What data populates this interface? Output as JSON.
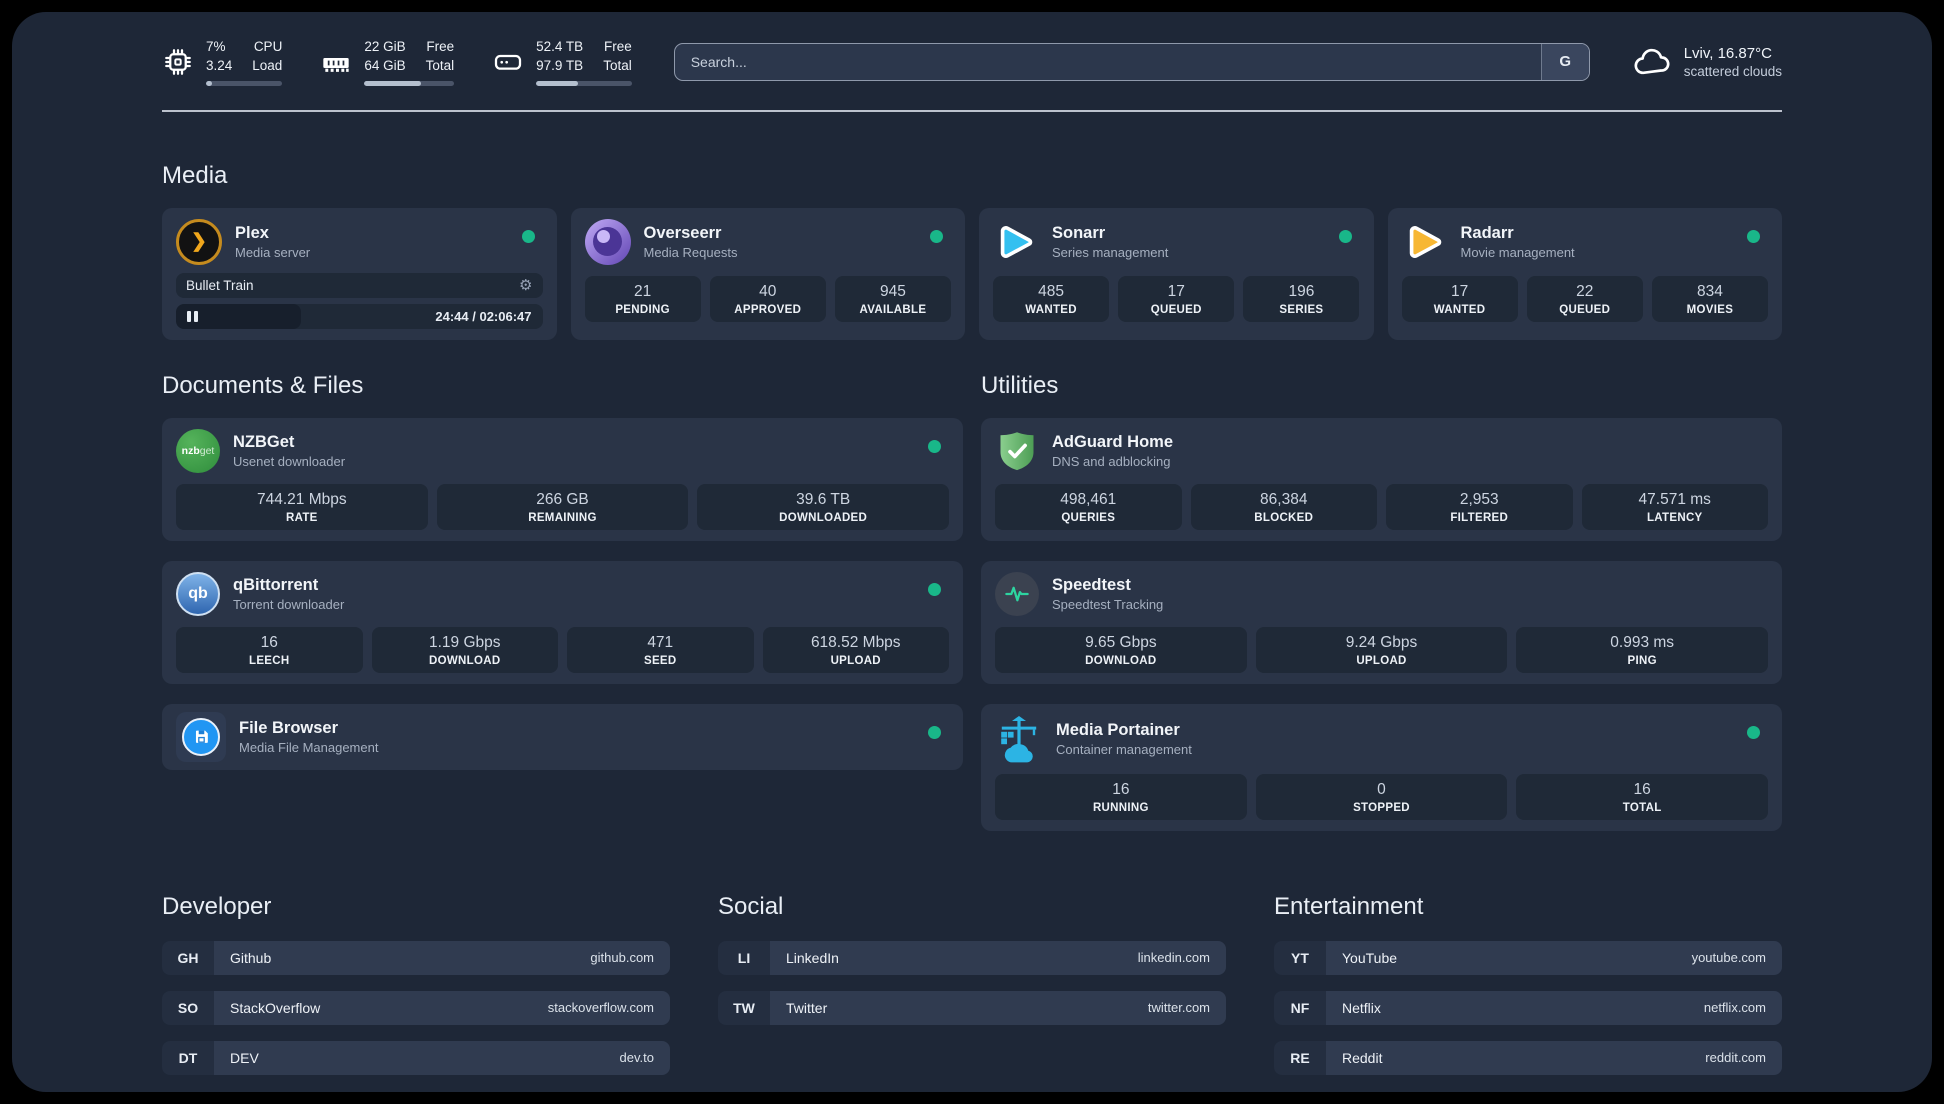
{
  "colors": {
    "status_green": "#19b789",
    "plex_orange": "#f0a71c",
    "sonarr_blue": "#33c0f0",
    "radarr_yellow": "#f7b733",
    "filebrowser_blue": "#2196f3",
    "speedtest_green": "#2dd4a0",
    "portainer_cyan": "#2cb4e4"
  },
  "header": {
    "system_stats": [
      {
        "icon": "cpu-icon",
        "values": [
          "7%",
          "3.24"
        ],
        "labels": [
          "CPU",
          "Load"
        ],
        "progress_percent": 8
      },
      {
        "icon": "ram-icon",
        "values": [
          "22 GiB",
          "64 GiB"
        ],
        "labels": [
          "Free",
          "Total"
        ],
        "progress_percent": 63
      },
      {
        "icon": "disk-icon",
        "values": [
          "52.4 TB",
          "97.9 TB"
        ],
        "labels": [
          "Free",
          "Total"
        ],
        "progress_percent": 44
      }
    ],
    "search": {
      "placeholder": "Search...",
      "button_label": "G"
    },
    "weather": {
      "location": "Lviv, 16.87°C",
      "condition": "scattered clouds"
    }
  },
  "sections": {
    "media": {
      "title": "Media",
      "plex": {
        "title": "Plex",
        "subtitle": "Media server",
        "now_playing": "Bullet Train",
        "time": "24:44 / 02:06:47",
        "elapsed_percent": 34
      },
      "overseerr": {
        "title": "Overseerr",
        "subtitle": "Media Requests",
        "stats": [
          {
            "value": "21",
            "label": "PENDING"
          },
          {
            "value": "40",
            "label": "APPROVED"
          },
          {
            "value": "945",
            "label": "AVAILABLE"
          }
        ]
      },
      "sonarr": {
        "title": "Sonarr",
        "subtitle": "Series management",
        "stats": [
          {
            "value": "485",
            "label": "WANTED"
          },
          {
            "value": "17",
            "label": "QUEUED"
          },
          {
            "value": "196",
            "label": "SERIES"
          }
        ]
      },
      "radarr": {
        "title": "Radarr",
        "subtitle": "Movie management",
        "stats": [
          {
            "value": "17",
            "label": "WANTED"
          },
          {
            "value": "22",
            "label": "QUEUED"
          },
          {
            "value": "834",
            "label": "MOVIES"
          }
        ]
      }
    },
    "documents": {
      "title": "Documents & Files",
      "nzbget": {
        "title": "NZBGet",
        "subtitle": "Usenet downloader",
        "icon_text_1": "nzb",
        "icon_text_2": "get",
        "stats": [
          {
            "value": "744.21 Mbps",
            "label": "RATE"
          },
          {
            "value": "266 GB",
            "label": "REMAINING"
          },
          {
            "value": "39.6 TB",
            "label": "DOWNLOADED"
          }
        ]
      },
      "qbittorrent": {
        "title": "qBittorrent",
        "subtitle": "Torrent downloader",
        "icon_text": "qb",
        "stats": [
          {
            "value": "16",
            "label": "LEECH"
          },
          {
            "value": "1.19 Gbps",
            "label": "DOWNLOAD"
          },
          {
            "value": "471",
            "label": "SEED"
          },
          {
            "value": "618.52 Mbps",
            "label": "UPLOAD"
          }
        ]
      },
      "filebrowser": {
        "title": "File Browser",
        "subtitle": "Media File Management"
      }
    },
    "utilities": {
      "title": "Utilities",
      "adguard": {
        "title": "AdGuard Home",
        "subtitle": "DNS and adblocking",
        "stats": [
          {
            "value": "498,461",
            "label": "QUERIES"
          },
          {
            "value": "86,384",
            "label": "BLOCKED"
          },
          {
            "value": "2,953",
            "label": "FILTERED"
          },
          {
            "value": "47.571 ms",
            "label": "LATENCY"
          }
        ]
      },
      "speedtest": {
        "title": "Speedtest",
        "subtitle": "Speedtest Tracking",
        "stats": [
          {
            "value": "9.65 Gbps",
            "label": "DOWNLOAD"
          },
          {
            "value": "9.24 Gbps",
            "label": "UPLOAD"
          },
          {
            "value": "0.993 ms",
            "label": "PING"
          }
        ]
      },
      "portainer": {
        "title": "Media Portainer",
        "subtitle": "Container management",
        "stats": [
          {
            "value": "16",
            "label": "RUNNING"
          },
          {
            "value": "0",
            "label": "STOPPED"
          },
          {
            "value": "16",
            "label": "TOTAL"
          }
        ]
      }
    },
    "links": [
      {
        "title": "Developer",
        "items": [
          {
            "abbr": "GH",
            "name": "Github",
            "url": "github.com"
          },
          {
            "abbr": "SO",
            "name": "StackOverflow",
            "url": "stackoverflow.com"
          },
          {
            "abbr": "DT",
            "name": "DEV",
            "url": "dev.to"
          }
        ]
      },
      {
        "title": "Social",
        "items": [
          {
            "abbr": "LI",
            "name": "LinkedIn",
            "url": "linkedin.com"
          },
          {
            "abbr": "TW",
            "name": "Twitter",
            "url": "twitter.com"
          }
        ]
      },
      {
        "title": "Entertainment",
        "items": [
          {
            "abbr": "YT",
            "name": "YouTube",
            "url": "youtube.com"
          },
          {
            "abbr": "NF",
            "name": "Netflix",
            "url": "netflix.com"
          },
          {
            "abbr": "RE",
            "name": "Reddit",
            "url": "reddit.com"
          }
        ]
      }
    ]
  }
}
